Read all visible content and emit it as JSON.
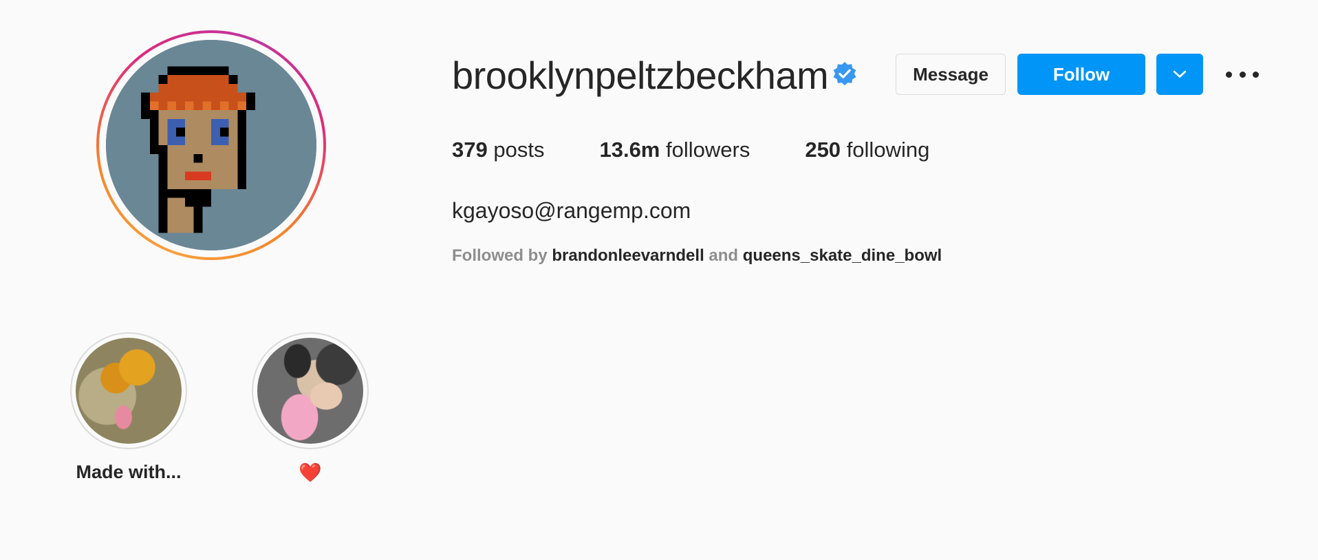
{
  "profile": {
    "username": "brooklynpeltzbeckham",
    "verified": true,
    "avatar_icon": "cryptopunk-pixel-avatar"
  },
  "actions": {
    "message_label": "Message",
    "follow_label": "Follow",
    "dropdown_icon": "chevron-down-icon",
    "more_icon": "more-horizontal-icon"
  },
  "stats": {
    "posts_count": "379",
    "posts_label": "posts",
    "followers_count": "13.6m",
    "followers_label": "followers",
    "following_count": "250",
    "following_label": "following"
  },
  "bio": {
    "text": "kgayoso@rangemp.com"
  },
  "followed_by": {
    "prefix": "Followed by",
    "account_1": "brandonleevarndell",
    "conjunction": "and",
    "account_2": "queens_skate_dine_bowl"
  },
  "highlights": [
    {
      "label": "Made with..."
    },
    {
      "label": "❤️"
    }
  ],
  "colors": {
    "accent": "#0095f6",
    "background": "#fafafa",
    "text": "#262626",
    "muted": "#8e8e8e",
    "verified": "#3897f0"
  }
}
